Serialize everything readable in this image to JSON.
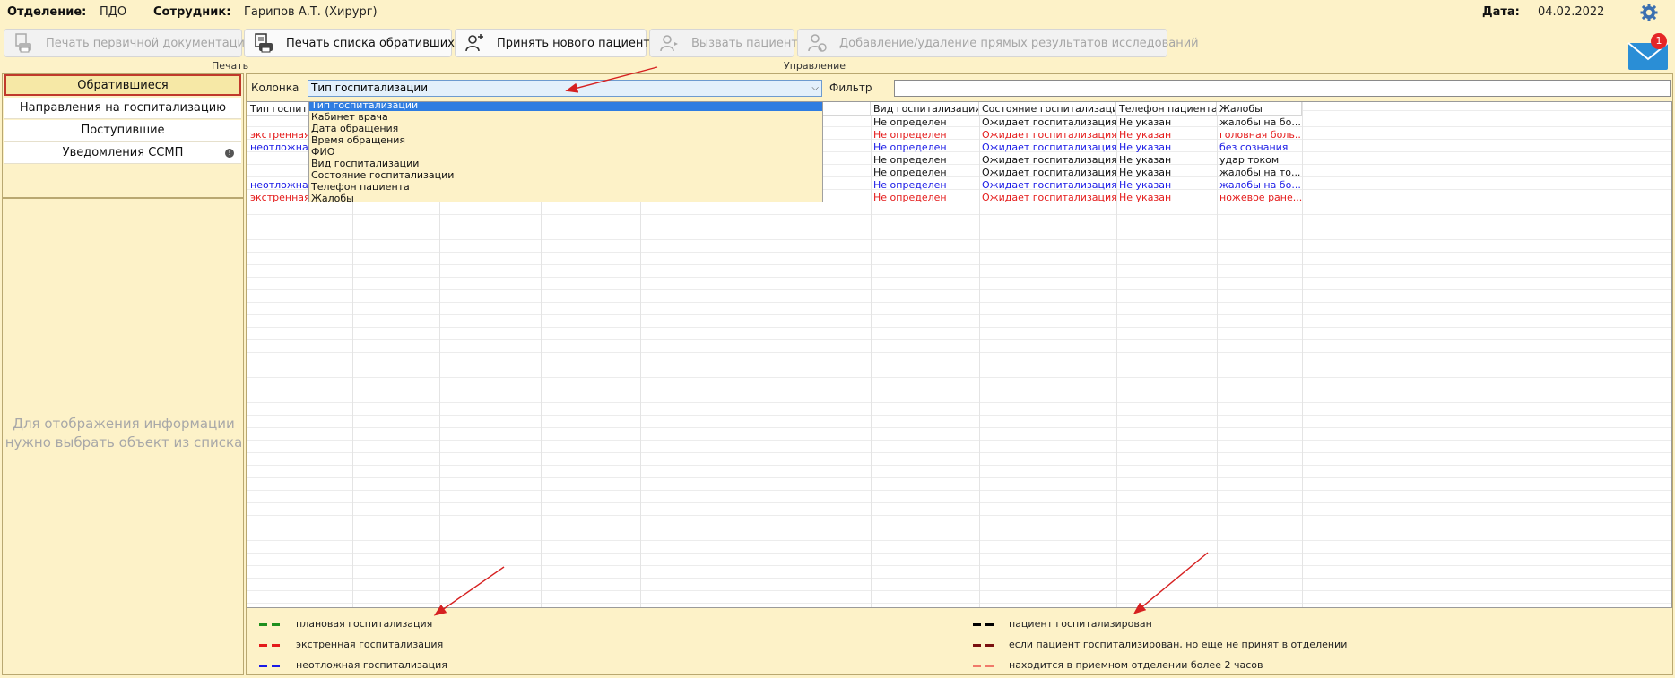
{
  "header": {
    "department_label": "Отделение:",
    "department_value": "ПДО",
    "employee_label": "Сотрудник:",
    "employee_value": "Гарипов А.Т. (Хирург)",
    "date_label": "Дата:",
    "date_value": "04.02.2022",
    "mail_badge": "1"
  },
  "toolbar": {
    "print_primary": "Печать первичной документации",
    "print_list": "Печать списка обратившихся",
    "accept_patient": "Принять нового пациента",
    "call_patient": "Вызвать пациента",
    "results": "Добавление/удаление прямых результатов исследований",
    "group_print": "Печать",
    "group_manage": "Управление"
  },
  "sidebar": {
    "items": [
      {
        "label": "Обратившиеся"
      },
      {
        "label": "Направления на госпитализацию"
      },
      {
        "label": "Поступившие"
      },
      {
        "label": "Уведомления ССМП"
      }
    ],
    "placeholder_line1": "Для отображения информации",
    "placeholder_line2": "нужно выбрать объект из списка"
  },
  "filter": {
    "column_label": "Колонка",
    "column_value": "Тип госпитализации",
    "filter_label": "Фильтр",
    "filter_value": "",
    "options": [
      "Тип госпитализации",
      "Кабинет врача",
      "Дата обращения",
      "Время обращения",
      "ФИО",
      "Вид госпитализации",
      "Состояние госпитализации",
      "Телефон пациента",
      "Жалобы"
    ]
  },
  "table": {
    "headers": {
      "type": "Тип госпита",
      "kind": "Вид госпитализации",
      "state": "Состояние госпитализации",
      "phone": "Телефон пациента",
      "complaints": "Жалобы"
    },
    "rows": [
      {
        "type": "",
        "kind": "Не определен",
        "state": "Ожидает госпитализация",
        "phone": "Не указан",
        "complaints": "жалобы на бо...",
        "color": "#111111"
      },
      {
        "type": "экстренная",
        "kind": "Не определен",
        "state": "Ожидает госпитализация",
        "phone": "Не указан",
        "complaints": "головная боль...",
        "color": "#e41b1b"
      },
      {
        "type": "неотложная",
        "kind": "Не определен",
        "state": "Ожидает госпитализация",
        "phone": "Не указан",
        "complaints": "без сознания",
        "color": "#1a1ae6"
      },
      {
        "type": "",
        "kind": "Не определен",
        "state": "Ожидает госпитализация",
        "phone": "Не указан",
        "complaints": "удар током",
        "color": "#111111"
      },
      {
        "type": "",
        "kind": "Не определен",
        "state": "Ожидает госпитализация",
        "phone": "Не указан",
        "complaints": "жалобы на то...",
        "color": "#111111"
      },
      {
        "type": "неотложная",
        "kind": "Не определен",
        "state": "Ожидает госпитализация",
        "phone": "Не указан",
        "complaints": "жалобы на бо...",
        "color": "#1a1ae6"
      },
      {
        "type": "экстренная",
        "kind": "Не определен",
        "state": "Ожидает госпитализация",
        "phone": "Не указан",
        "complaints": "ножевое ране...",
        "color": "#e41b1b"
      }
    ]
  },
  "legend": {
    "planned": {
      "label": "плановая госпитализация",
      "color": "#1e8f1e"
    },
    "emergency": {
      "label": "экстренная госпитализация",
      "color": "#e41b1b"
    },
    "urgent": {
      "label": "неотложная госпитализация",
      "color": "#1a1ae6"
    },
    "hospitalized": {
      "label": "пациент госпитализирован",
      "color": "#000000"
    },
    "not_accepted": {
      "label": "если пациент госпитализирован, но еще не принят в  отделении",
      "color": "#7a1010"
    },
    "over_2h": {
      "label": "находится в приемном отделении более 2 часов",
      "color": "#f07a6a"
    }
  }
}
